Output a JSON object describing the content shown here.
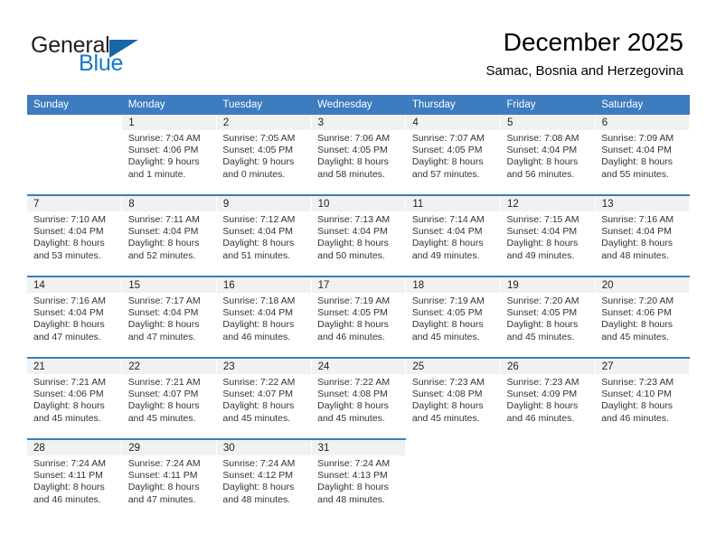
{
  "brand": {
    "line1": "General",
    "line2": "Blue",
    "triangle_icon": "brand-triangle-icon",
    "color_dark": "#231f20",
    "color_blue": "#1878c8"
  },
  "header": {
    "title": "December 2025",
    "subtitle": "Samac, Bosnia and Herzegovina"
  },
  "colors": {
    "header_blue": "#3c7cbf",
    "daynum_band": "#f1f1f1",
    "text": "#333333"
  },
  "weekday_headers": [
    "Sunday",
    "Monday",
    "Tuesday",
    "Wednesday",
    "Thursday",
    "Friday",
    "Saturday"
  ],
  "weeks": [
    [
      {
        "day": "",
        "sunrise": "",
        "sunset": "",
        "daylight1": "",
        "daylight2": ""
      },
      {
        "day": "1",
        "sunrise": "Sunrise: 7:04 AM",
        "sunset": "Sunset: 4:06 PM",
        "daylight1": "Daylight: 9 hours",
        "daylight2": "and 1 minute."
      },
      {
        "day": "2",
        "sunrise": "Sunrise: 7:05 AM",
        "sunset": "Sunset: 4:05 PM",
        "daylight1": "Daylight: 9 hours",
        "daylight2": "and 0 minutes."
      },
      {
        "day": "3",
        "sunrise": "Sunrise: 7:06 AM",
        "sunset": "Sunset: 4:05 PM",
        "daylight1": "Daylight: 8 hours",
        "daylight2": "and 58 minutes."
      },
      {
        "day": "4",
        "sunrise": "Sunrise: 7:07 AM",
        "sunset": "Sunset: 4:05 PM",
        "daylight1": "Daylight: 8 hours",
        "daylight2": "and 57 minutes."
      },
      {
        "day": "5",
        "sunrise": "Sunrise: 7:08 AM",
        "sunset": "Sunset: 4:04 PM",
        "daylight1": "Daylight: 8 hours",
        "daylight2": "and 56 minutes."
      },
      {
        "day": "6",
        "sunrise": "Sunrise: 7:09 AM",
        "sunset": "Sunset: 4:04 PM",
        "daylight1": "Daylight: 8 hours",
        "daylight2": "and 55 minutes."
      }
    ],
    [
      {
        "day": "7",
        "sunrise": "Sunrise: 7:10 AM",
        "sunset": "Sunset: 4:04 PM",
        "daylight1": "Daylight: 8 hours",
        "daylight2": "and 53 minutes."
      },
      {
        "day": "8",
        "sunrise": "Sunrise: 7:11 AM",
        "sunset": "Sunset: 4:04 PM",
        "daylight1": "Daylight: 8 hours",
        "daylight2": "and 52 minutes."
      },
      {
        "day": "9",
        "sunrise": "Sunrise: 7:12 AM",
        "sunset": "Sunset: 4:04 PM",
        "daylight1": "Daylight: 8 hours",
        "daylight2": "and 51 minutes."
      },
      {
        "day": "10",
        "sunrise": "Sunrise: 7:13 AM",
        "sunset": "Sunset: 4:04 PM",
        "daylight1": "Daylight: 8 hours",
        "daylight2": "and 50 minutes."
      },
      {
        "day": "11",
        "sunrise": "Sunrise: 7:14 AM",
        "sunset": "Sunset: 4:04 PM",
        "daylight1": "Daylight: 8 hours",
        "daylight2": "and 49 minutes."
      },
      {
        "day": "12",
        "sunrise": "Sunrise: 7:15 AM",
        "sunset": "Sunset: 4:04 PM",
        "daylight1": "Daylight: 8 hours",
        "daylight2": "and 49 minutes."
      },
      {
        "day": "13",
        "sunrise": "Sunrise: 7:16 AM",
        "sunset": "Sunset: 4:04 PM",
        "daylight1": "Daylight: 8 hours",
        "daylight2": "and 48 minutes."
      }
    ],
    [
      {
        "day": "14",
        "sunrise": "Sunrise: 7:16 AM",
        "sunset": "Sunset: 4:04 PM",
        "daylight1": "Daylight: 8 hours",
        "daylight2": "and 47 minutes."
      },
      {
        "day": "15",
        "sunrise": "Sunrise: 7:17 AM",
        "sunset": "Sunset: 4:04 PM",
        "daylight1": "Daylight: 8 hours",
        "daylight2": "and 47 minutes."
      },
      {
        "day": "16",
        "sunrise": "Sunrise: 7:18 AM",
        "sunset": "Sunset: 4:04 PM",
        "daylight1": "Daylight: 8 hours",
        "daylight2": "and 46 minutes."
      },
      {
        "day": "17",
        "sunrise": "Sunrise: 7:19 AM",
        "sunset": "Sunset: 4:05 PM",
        "daylight1": "Daylight: 8 hours",
        "daylight2": "and 46 minutes."
      },
      {
        "day": "18",
        "sunrise": "Sunrise: 7:19 AM",
        "sunset": "Sunset: 4:05 PM",
        "daylight1": "Daylight: 8 hours",
        "daylight2": "and 45 minutes."
      },
      {
        "day": "19",
        "sunrise": "Sunrise: 7:20 AM",
        "sunset": "Sunset: 4:05 PM",
        "daylight1": "Daylight: 8 hours",
        "daylight2": "and 45 minutes."
      },
      {
        "day": "20",
        "sunrise": "Sunrise: 7:20 AM",
        "sunset": "Sunset: 4:06 PM",
        "daylight1": "Daylight: 8 hours",
        "daylight2": "and 45 minutes."
      }
    ],
    [
      {
        "day": "21",
        "sunrise": "Sunrise: 7:21 AM",
        "sunset": "Sunset: 4:06 PM",
        "daylight1": "Daylight: 8 hours",
        "daylight2": "and 45 minutes."
      },
      {
        "day": "22",
        "sunrise": "Sunrise: 7:21 AM",
        "sunset": "Sunset: 4:07 PM",
        "daylight1": "Daylight: 8 hours",
        "daylight2": "and 45 minutes."
      },
      {
        "day": "23",
        "sunrise": "Sunrise: 7:22 AM",
        "sunset": "Sunset: 4:07 PM",
        "daylight1": "Daylight: 8 hours",
        "daylight2": "and 45 minutes."
      },
      {
        "day": "24",
        "sunrise": "Sunrise: 7:22 AM",
        "sunset": "Sunset: 4:08 PM",
        "daylight1": "Daylight: 8 hours",
        "daylight2": "and 45 minutes."
      },
      {
        "day": "25",
        "sunrise": "Sunrise: 7:23 AM",
        "sunset": "Sunset: 4:08 PM",
        "daylight1": "Daylight: 8 hours",
        "daylight2": "and 45 minutes."
      },
      {
        "day": "26",
        "sunrise": "Sunrise: 7:23 AM",
        "sunset": "Sunset: 4:09 PM",
        "daylight1": "Daylight: 8 hours",
        "daylight2": "and 46 minutes."
      },
      {
        "day": "27",
        "sunrise": "Sunrise: 7:23 AM",
        "sunset": "Sunset: 4:10 PM",
        "daylight1": "Daylight: 8 hours",
        "daylight2": "and 46 minutes."
      }
    ],
    [
      {
        "day": "28",
        "sunrise": "Sunrise: 7:24 AM",
        "sunset": "Sunset: 4:11 PM",
        "daylight1": "Daylight: 8 hours",
        "daylight2": "and 46 minutes."
      },
      {
        "day": "29",
        "sunrise": "Sunrise: 7:24 AM",
        "sunset": "Sunset: 4:11 PM",
        "daylight1": "Daylight: 8 hours",
        "daylight2": "and 47 minutes."
      },
      {
        "day": "30",
        "sunrise": "Sunrise: 7:24 AM",
        "sunset": "Sunset: 4:12 PM",
        "daylight1": "Daylight: 8 hours",
        "daylight2": "and 48 minutes."
      },
      {
        "day": "31",
        "sunrise": "Sunrise: 7:24 AM",
        "sunset": "Sunset: 4:13 PM",
        "daylight1": "Daylight: 8 hours",
        "daylight2": "and 48 minutes."
      },
      {
        "day": "",
        "sunrise": "",
        "sunset": "",
        "daylight1": "",
        "daylight2": ""
      },
      {
        "day": "",
        "sunrise": "",
        "sunset": "",
        "daylight1": "",
        "daylight2": ""
      },
      {
        "day": "",
        "sunrise": "",
        "sunset": "",
        "daylight1": "",
        "daylight2": ""
      }
    ]
  ]
}
